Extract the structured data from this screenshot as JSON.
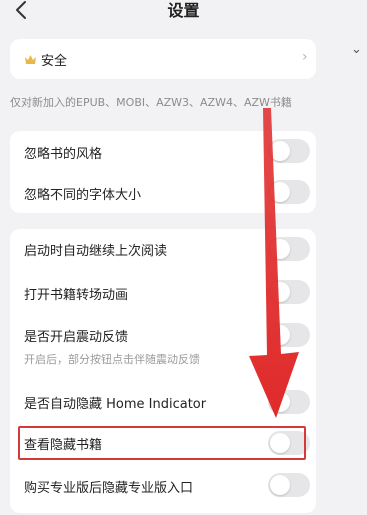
{
  "nav": {
    "back_icon": "chevron-left-icon",
    "title": "设置"
  },
  "security": {
    "icon": "crown-icon",
    "label": "安全",
    "chevron": "›"
  },
  "note": {
    "text": "仅对新加入的EPUB、MOBI、AZW3、AZW4、AZW书籍"
  },
  "group1": [
    {
      "label": "忽略书的风格",
      "on": false
    },
    {
      "label": "忽略不同的字体大小",
      "on": false
    }
  ],
  "group2": [
    {
      "label": "启动时自动继续上次阅读",
      "on": false
    },
    {
      "label": "打开书籍转场动画",
      "on": false
    },
    {
      "label": "是否开启震动反馈",
      "sub": "开启后，部分按钮点击伴随震动反馈",
      "on": false
    },
    {
      "label": "是否自动隐藏 Home Indicator",
      "on": false
    },
    {
      "label": "查看隐藏书籍",
      "on": false
    },
    {
      "label": "购买专业版后隐藏专业版入口",
      "on": false
    }
  ],
  "side": {
    "chevron_icon": "chevron-down-icon",
    "chevron": "⌄"
  },
  "colors": {
    "accent": "#e02a2a",
    "highlight_border": "#d43a3a",
    "background": "#f2f2f4"
  }
}
